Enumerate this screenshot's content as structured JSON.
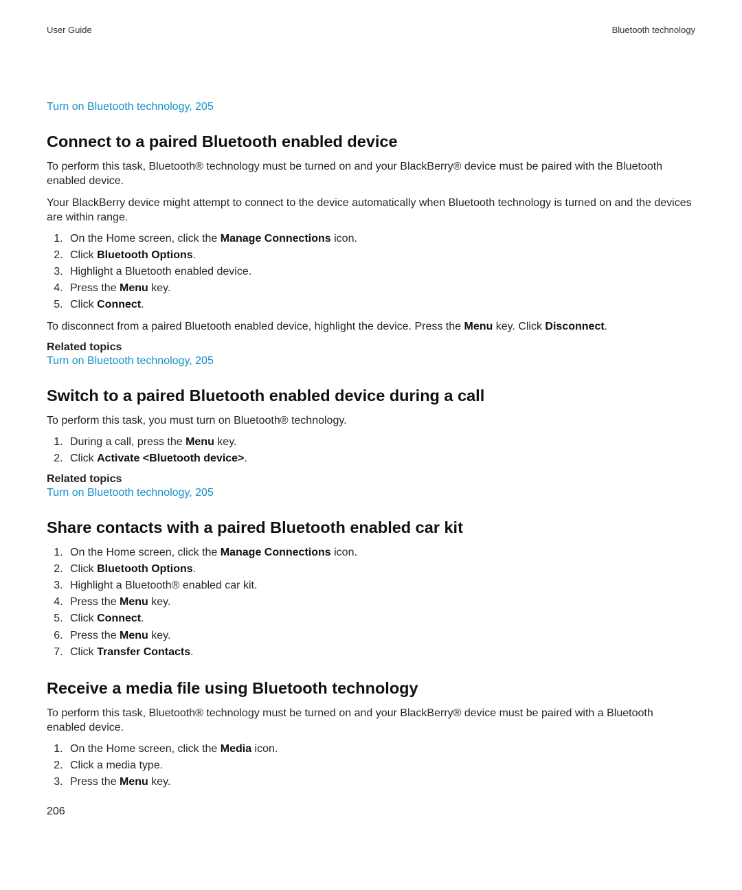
{
  "header": {
    "left": "User Guide",
    "right": "Bluetooth technology"
  },
  "top_link": "Turn on Bluetooth technology, 205",
  "sec1": {
    "title": "Connect to a paired Bluetooth enabled device",
    "intro1": "To perform this task, Bluetooth® technology must be turned on and your BlackBerry® device must be paired with the Bluetooth enabled device.",
    "intro2": "Your BlackBerry device might attempt to connect to the device automatically when Bluetooth technology is turned on and the devices are within range.",
    "steps": [
      {
        "pre": "On the Home screen, click the ",
        "b": "Manage Connections",
        "post": " icon."
      },
      {
        "pre": "Click ",
        "b": "Bluetooth Options",
        "post": "."
      },
      {
        "pre": "Highlight a Bluetooth enabled device.",
        "b": "",
        "post": ""
      },
      {
        "pre": "Press the ",
        "b": "Menu",
        "post": " key."
      },
      {
        "pre": "Click ",
        "b": "Connect",
        "post": "."
      }
    ],
    "after_pre": "To disconnect from a paired Bluetooth enabled device, highlight the device. Press the ",
    "after_b1": "Menu",
    "after_mid": " key. Click ",
    "after_b2": "Disconnect",
    "after_post": ".",
    "related_heading": "Related topics",
    "related_link": "Turn on Bluetooth technology, 205"
  },
  "sec2": {
    "title": "Switch to a paired Bluetooth enabled device during a call",
    "intro": "To perform this task, you must turn on Bluetooth® technology.",
    "steps": [
      {
        "pre": "During a call, press the ",
        "b": "Menu",
        "post": " key."
      },
      {
        "pre": "Click ",
        "b": "Activate <Bluetooth device>",
        "post": "."
      }
    ],
    "related_heading": "Related topics",
    "related_link": "Turn on Bluetooth technology, 205"
  },
  "sec3": {
    "title": "Share contacts with a paired Bluetooth enabled car kit",
    "steps": [
      {
        "pre": "On the Home screen, click the ",
        "b": "Manage Connections",
        "post": " icon."
      },
      {
        "pre": "Click ",
        "b": "Bluetooth Options",
        "post": "."
      },
      {
        "pre": "Highlight a Bluetooth",
        "reg": "® enabled car kit."
      },
      {
        "pre": "Press the ",
        "b": "Menu",
        "post": " key."
      },
      {
        "pre": "Click ",
        "b": "Connect",
        "post": "."
      },
      {
        "pre": "Press the ",
        "b": "Menu",
        "post": " key."
      },
      {
        "pre": "Click ",
        "b": "Transfer Contacts",
        "post": "."
      }
    ]
  },
  "sec4": {
    "title": "Receive a media file using Bluetooth technology",
    "intro": "To perform this task, Bluetooth® technology must be turned on and your BlackBerry® device must be paired with a Bluetooth enabled device.",
    "steps": [
      {
        "pre": "On the Home screen, click the ",
        "b": "Media",
        "post": " icon."
      },
      {
        "pre": "Click a media type.",
        "b": "",
        "post": ""
      },
      {
        "pre": "Press the ",
        "b": "Menu",
        "post": " key."
      }
    ]
  },
  "page_number": "206"
}
